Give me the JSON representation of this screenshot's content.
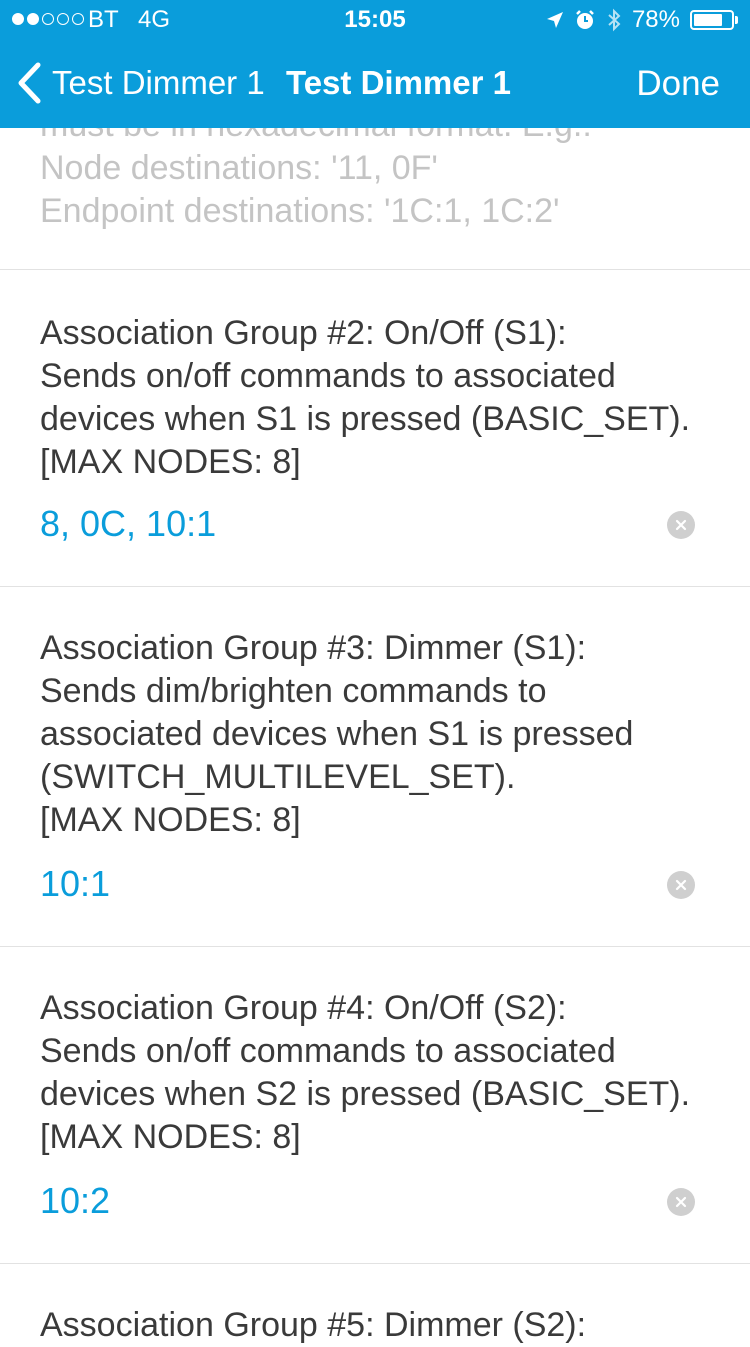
{
  "status_bar": {
    "carrier": "BT",
    "network": "4G",
    "time": "15:05",
    "battery_percent": "78%",
    "battery_level": 0.78,
    "signal_strength": 2,
    "icons": [
      "location-arrow-icon",
      "alarm-clock-icon",
      "bluetooth-icon",
      "battery-icon"
    ]
  },
  "nav": {
    "back_label": "Test Dimmer 1",
    "title": "Test Dimmer 1",
    "done_label": "Done"
  },
  "helper": {
    "lines": "must be in hexadecimal format. E.g.:\nNode destinations: '11, 0F'\nEndpoint destinations: '1C:1, 1C:2'"
  },
  "groups": [
    {
      "description": "Association Group #2: On/Off (S1):\nSends on/off commands to associated\ndevices when S1 is pressed (BASIC_SET).\n[MAX NODES: 8]",
      "value": "8, 0C, 10:1"
    },
    {
      "description": "Association Group #3: Dimmer (S1):\nSends dim/brighten commands to\nassociated devices when S1 is pressed\n(SWITCH_MULTILEVEL_SET).\n[MAX NODES: 8]",
      "value": "10:1"
    },
    {
      "description": "Association Group #4: On/Off (S2):\nSends on/off commands to associated\ndevices when S2 is pressed (BASIC_SET).\n[MAX NODES: 8]",
      "value": "10:2"
    },
    {
      "description": "Association Group #5: Dimmer (S2):"
    }
  ],
  "colors": {
    "accent": "#0a9ddb",
    "text": "#3a3a3a",
    "helper_text": "#c4c4c4",
    "separator": "#e2e2e2",
    "clear_button": "#cfcfcf"
  }
}
